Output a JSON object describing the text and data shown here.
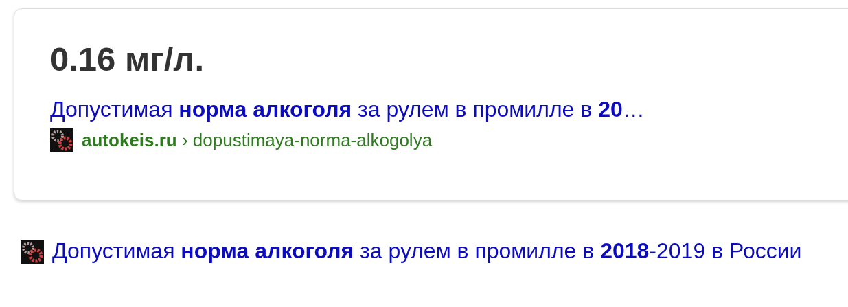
{
  "answer_card": {
    "answer": "0.16 мг/л.",
    "link": "Допустимая **норма алкоголя** за рулем в промилле в **20**…",
    "domain": "autokeis.ru",
    "separator": "›",
    "path": "dopustimaya-norma-alkogolya"
  },
  "result": {
    "link": "Допустимая **норма алкоголя** за рулем в промилле в **2018**-2019 в России"
  }
}
